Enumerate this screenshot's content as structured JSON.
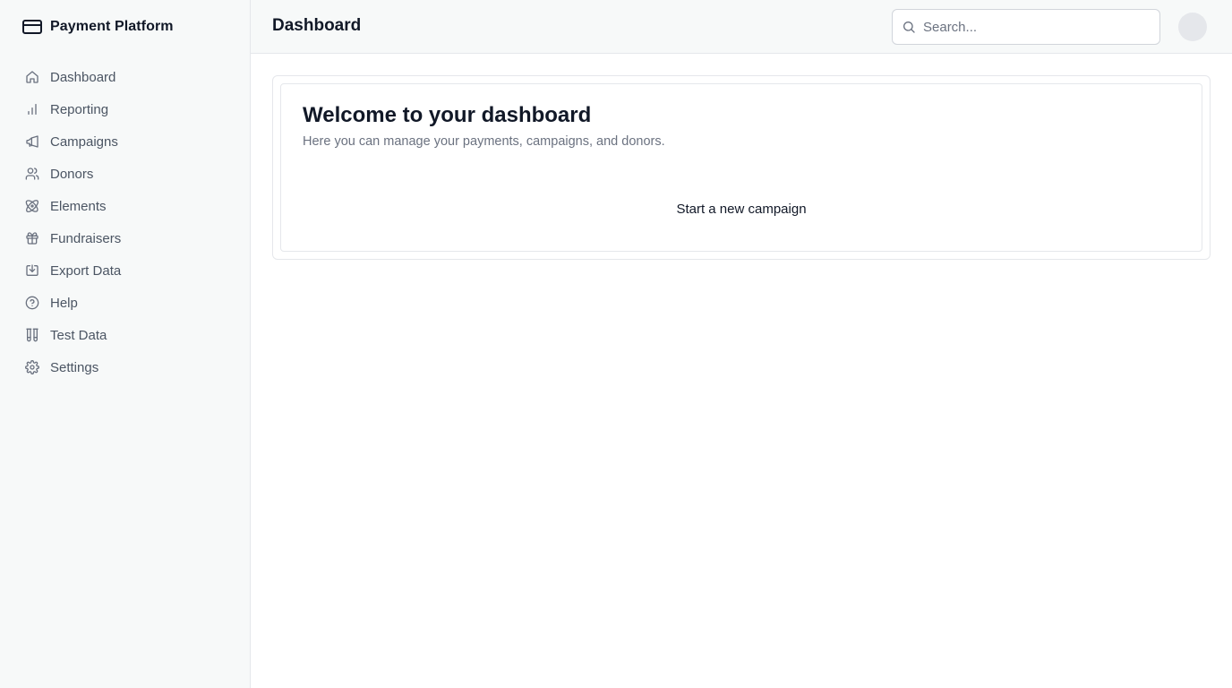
{
  "app": {
    "name": "Payment Platform"
  },
  "sidebar": {
    "items": [
      {
        "label": "Dashboard",
        "icon": "home-icon"
      },
      {
        "label": "Reporting",
        "icon": "bar-chart-icon"
      },
      {
        "label": "Campaigns",
        "icon": "megaphone-icon"
      },
      {
        "label": "Donors",
        "icon": "users-icon"
      },
      {
        "label": "Elements",
        "icon": "atom-icon"
      },
      {
        "label": "Fundraisers",
        "icon": "gift-icon"
      },
      {
        "label": "Export Data",
        "icon": "download-icon"
      },
      {
        "label": "Help",
        "icon": "help-circle-icon"
      },
      {
        "label": "Test Data",
        "icon": "test-tubes-icon"
      },
      {
        "label": "Settings",
        "icon": "gear-icon"
      }
    ]
  },
  "header": {
    "title": "Dashboard",
    "search_placeholder": "Search..."
  },
  "main": {
    "welcome_title": "Welcome to your dashboard",
    "welcome_subtitle": "Here you can manage your payments, campaigns, and donors.",
    "cta_label": "Start a new campaign"
  },
  "colors": {
    "sidebar_bg": "#f7f9f9",
    "border": "#e5e7eb",
    "text_primary": "#111827",
    "text_secondary": "#6b7280"
  }
}
